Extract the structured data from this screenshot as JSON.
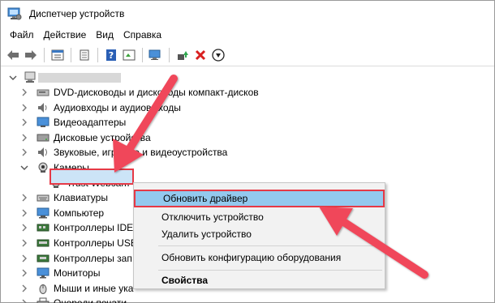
{
  "window": {
    "title": "Диспетчер устройств"
  },
  "menu": [
    "Файл",
    "Действие",
    "Вид",
    "Справка"
  ],
  "tree": {
    "items": [
      {
        "label": "DVD-дисководы и дисководы компакт-дисков",
        "icon": "dvd-icon"
      },
      {
        "label": "Аудиовходы и аудиовыходы",
        "icon": "speaker-icon"
      },
      {
        "label": "Видеоадаптеры",
        "icon": "display-adapter-icon"
      },
      {
        "label": "Дисковые устройства",
        "icon": "disk-drive-icon"
      },
      {
        "label": "Звуковые, игровые и видеоустройства",
        "icon": "sound-icon"
      },
      {
        "label": "Камеры",
        "icon": "camera-icon"
      },
      {
        "label": "Trust Webcam",
        "icon": "webcam-icon"
      },
      {
        "label": "Клавиатуры",
        "icon": "keyboard-icon"
      },
      {
        "label": "Компьютер",
        "icon": "computer-icon"
      },
      {
        "label": "Контроллеры IDE",
        "icon": "ide-icon"
      },
      {
        "label": "Контроллеры USB",
        "icon": "usb-icon"
      },
      {
        "label": "Контроллеры зап",
        "icon": "storage-icon"
      },
      {
        "label": "Мониторы",
        "icon": "monitor-icon"
      },
      {
        "label": "Мыши и иные ука",
        "icon": "mouse-icon"
      },
      {
        "label": "Очереди печати",
        "icon": "printer-icon"
      }
    ]
  },
  "context_menu": {
    "items": [
      {
        "label": "Обновить драйвер"
      },
      {
        "label": "Отключить устройство"
      },
      {
        "label": "Удалить устройство"
      },
      {
        "label": "Обновить конфигурацию оборудования"
      },
      {
        "label": "Свойства"
      }
    ]
  },
  "colors": {
    "annotation": "#e63946",
    "highlight": "#93c9ee",
    "selection": "#cce4f7"
  }
}
